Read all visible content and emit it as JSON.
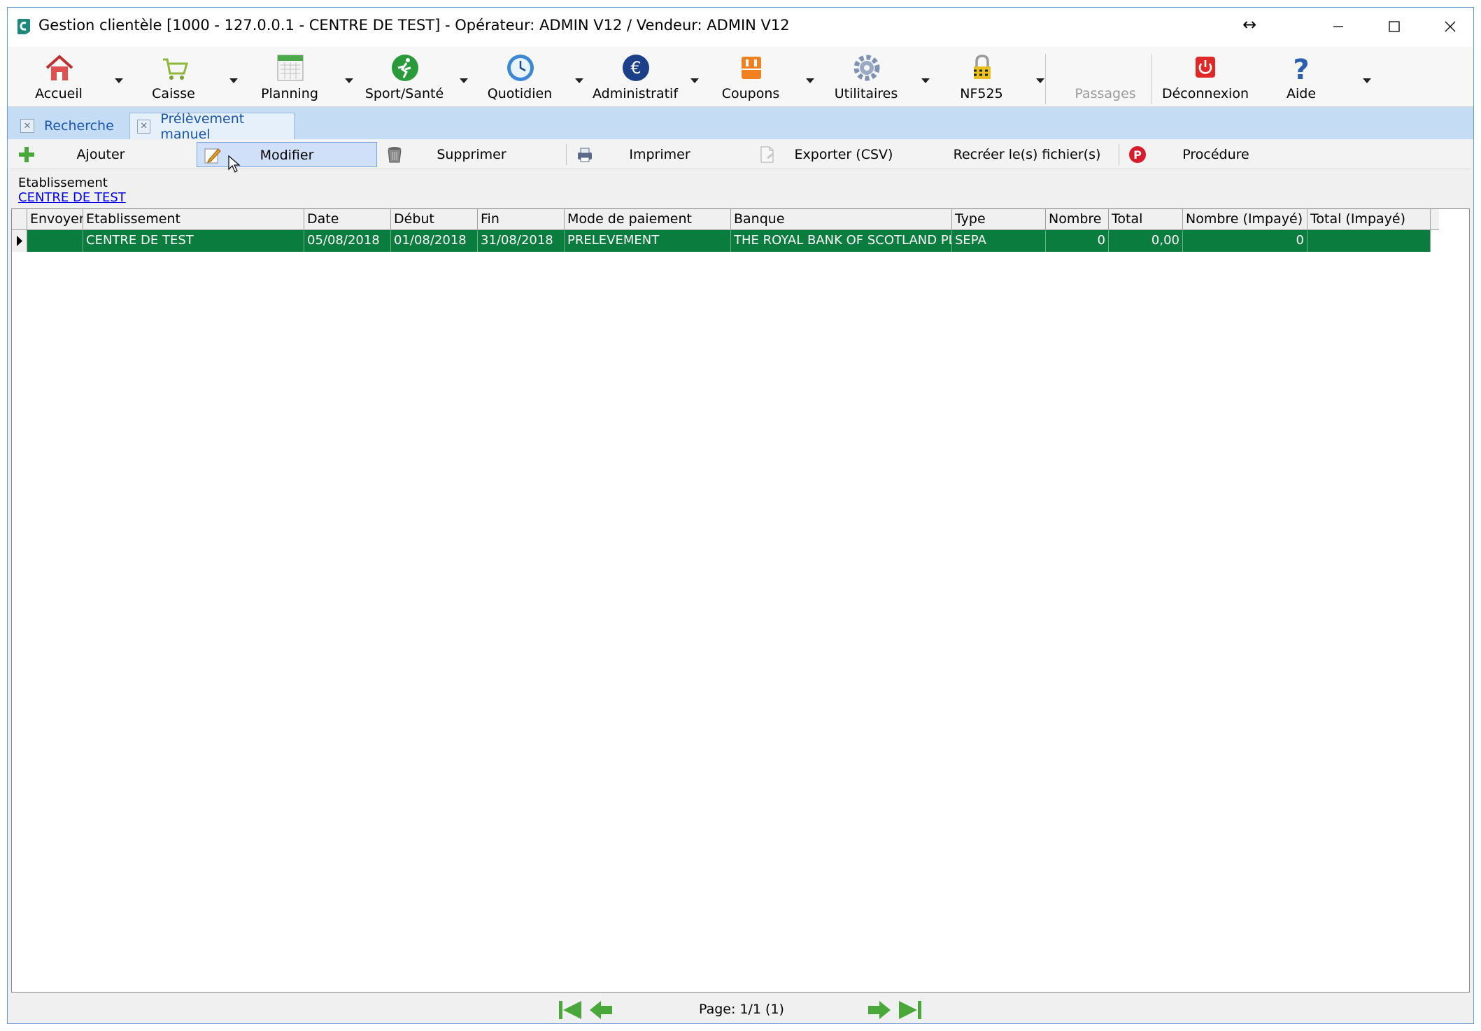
{
  "window": {
    "title": "Gestion clientèle [1000 - 127.0.0.1 - CENTRE DE TEST] - Opérateur: ADMIN V12 / Vendeur: ADMIN V12",
    "controls": [
      "minimize-icon",
      "maximize-icon",
      "close-icon"
    ]
  },
  "toolbar": {
    "items": [
      {
        "label": "Accueil",
        "icon": "home-icon"
      },
      {
        "label": "Caisse",
        "icon": "cart-icon"
      },
      {
        "label": "Planning",
        "icon": "calendar-icon"
      },
      {
        "label": "Sport/Santé",
        "icon": "runner-icon"
      },
      {
        "label": "Quotidien",
        "icon": "clock-icon"
      },
      {
        "label": "Administratif",
        "icon": "euro-icon"
      },
      {
        "label": "Coupons",
        "icon": "coupon-icon"
      },
      {
        "label": "Utilitaires",
        "icon": "gear-icon"
      },
      {
        "label": "NF525",
        "icon": "lock-icon"
      },
      {
        "label": "Passages",
        "disabled": true
      },
      {
        "label": "Déconnexion",
        "icon": "power-icon"
      },
      {
        "label": "Aide",
        "icon": "help-icon"
      }
    ]
  },
  "tabs": [
    {
      "label": "Recherche",
      "active": false
    },
    {
      "label": "Prélèvement manuel",
      "active": true
    }
  ],
  "actions": {
    "add": "Ajouter",
    "edit": "Modifier",
    "delete": "Supprimer",
    "print": "Imprimer",
    "export": "Exporter (CSV)",
    "recreate": "Recréer le(s) fichier(s)",
    "procedure": "Procédure"
  },
  "filter": {
    "label": "Etablissement",
    "value": "CENTRE DE TEST"
  },
  "grid": {
    "columns": [
      "Envoyer",
      "Etablissement",
      "Date",
      "Début",
      "Fin",
      "Mode de paiement",
      "Banque",
      "Type",
      "Nombre",
      "Total",
      "Nombre (Impayé)",
      "Total (Impayé)"
    ],
    "rows": [
      {
        "envoyer": "",
        "etablissement": "CENTRE DE TEST",
        "date": "05/08/2018",
        "debut": "01/08/2018",
        "fin": "31/08/2018",
        "mode": "PRELEVEMENT",
        "banque": "THE ROYAL BANK OF SCOTLAND PLC",
        "type": "SEPA",
        "nombre": "0",
        "total": "0,00",
        "nombre_impaye": "0",
        "total_impaye": ""
      }
    ],
    "selected_color": "#0a7d3e"
  },
  "pager": {
    "label": "Page: 1/1 (1)"
  }
}
